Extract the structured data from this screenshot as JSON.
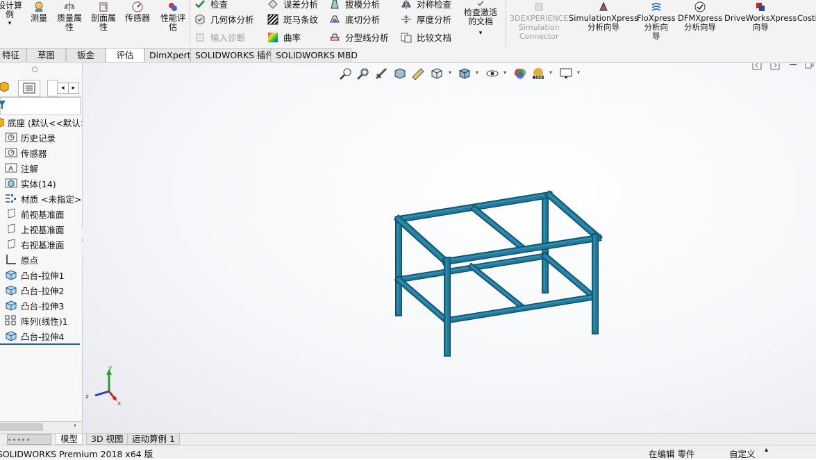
{
  "ribbon": {
    "design_calc": "设计算\n例",
    "measure": "测量",
    "mass_props": "质量属\n性",
    "section_props": "剖面属\n性",
    "sensor": "传感器",
    "perf_eval": "性能评\n估",
    "check": "检查",
    "geometry_analysis": "几何体分析",
    "import_diagnosis": "输入诊断",
    "interference": "误差分析",
    "zebra": "斑马条纹",
    "curvature": "曲率",
    "draft": "拔模分析",
    "undercut": "底切分析",
    "parting_line": "分型线分析",
    "symmetry": "对称检查",
    "thickness": "厚度分析",
    "compare": "比较文档",
    "check_active": "检查激活\n的文档",
    "experience_sim": "3DEXPERIENCE\nSimulation\nConnector",
    "simxpress": "SimulationXpress\n分析向导",
    "floxpress": "FloXpress\n分析向\n导",
    "dfmxpress": "DFMXpress\n分析向导",
    "driveworks": "DriveWorksXpress\n向导",
    "costing": "Costi"
  },
  "command_tabs": [
    "特征",
    "草图",
    "钣金",
    "评估",
    "DimXpert",
    "SOLIDWORKS 插件",
    "SOLIDWORKS MBD"
  ],
  "active_command_tab": "评估",
  "feature_tree": {
    "root": "底座 (默认<<默认>",
    "items": [
      "历史记录",
      "传感器",
      "注解",
      "实体(14)",
      "材质 <未指定>",
      "前视基准面",
      "上视基准面",
      "右视基准面",
      "原点",
      "凸台-拉伸1",
      "凸台-拉伸2",
      "凸台-拉伸3",
      "阵列(线性)1",
      "凸台-拉伸4"
    ]
  },
  "triad": {
    "x": "x",
    "y": "y",
    "z": "z"
  },
  "bottom_tabs": [
    "模型",
    "3D 视图",
    "运动算例 1"
  ],
  "status": {
    "app": "SOLIDWORKS Premium 2018 x64 版",
    "editing": "在编辑 零件",
    "custom": "自定义"
  },
  "colors": {
    "frame": "#1f7a9b",
    "frame_dark": "#0f4f68",
    "frame_light": "#3a9bbd"
  }
}
